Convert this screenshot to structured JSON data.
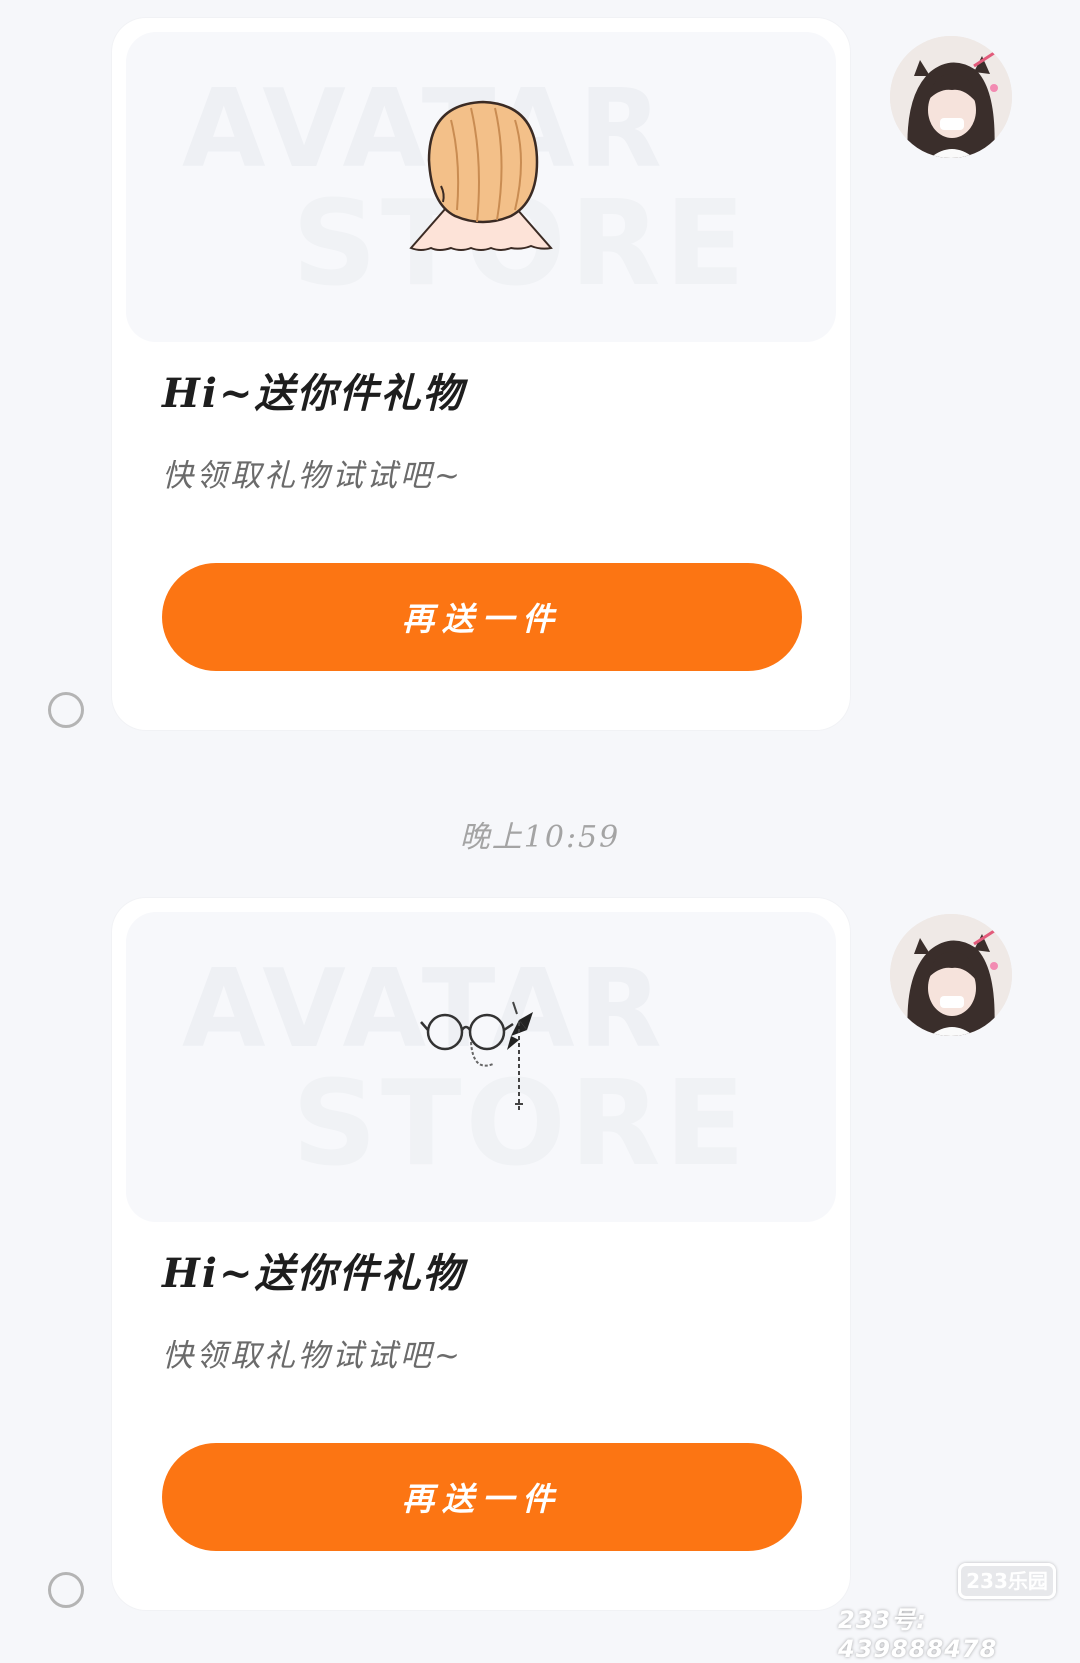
{
  "messages": [
    {
      "watermark_top": "AVATAR",
      "watermark_bottom": "STORE",
      "item_icon": "hair-icon",
      "title": "Hi~送你件礼物",
      "subtitle": "快领取礼物试试吧~",
      "button_label": "再送一件",
      "avatar_icon": "user-avatar"
    },
    {
      "watermark_top": "AVATAR",
      "watermark_bottom": "STORE",
      "item_icon": "glasses-icon",
      "title": "Hi~送你件礼物",
      "subtitle": "快领取礼物试试吧~",
      "button_label": "再送一件",
      "avatar_icon": "user-avatar"
    }
  ],
  "timestamp": "晚上10:59",
  "site_watermark": {
    "logo": "233乐园",
    "id_text": "233号: 439888478"
  },
  "colors": {
    "accent": "#fc7513",
    "background": "#f6f7fa",
    "card": "#ffffff"
  }
}
